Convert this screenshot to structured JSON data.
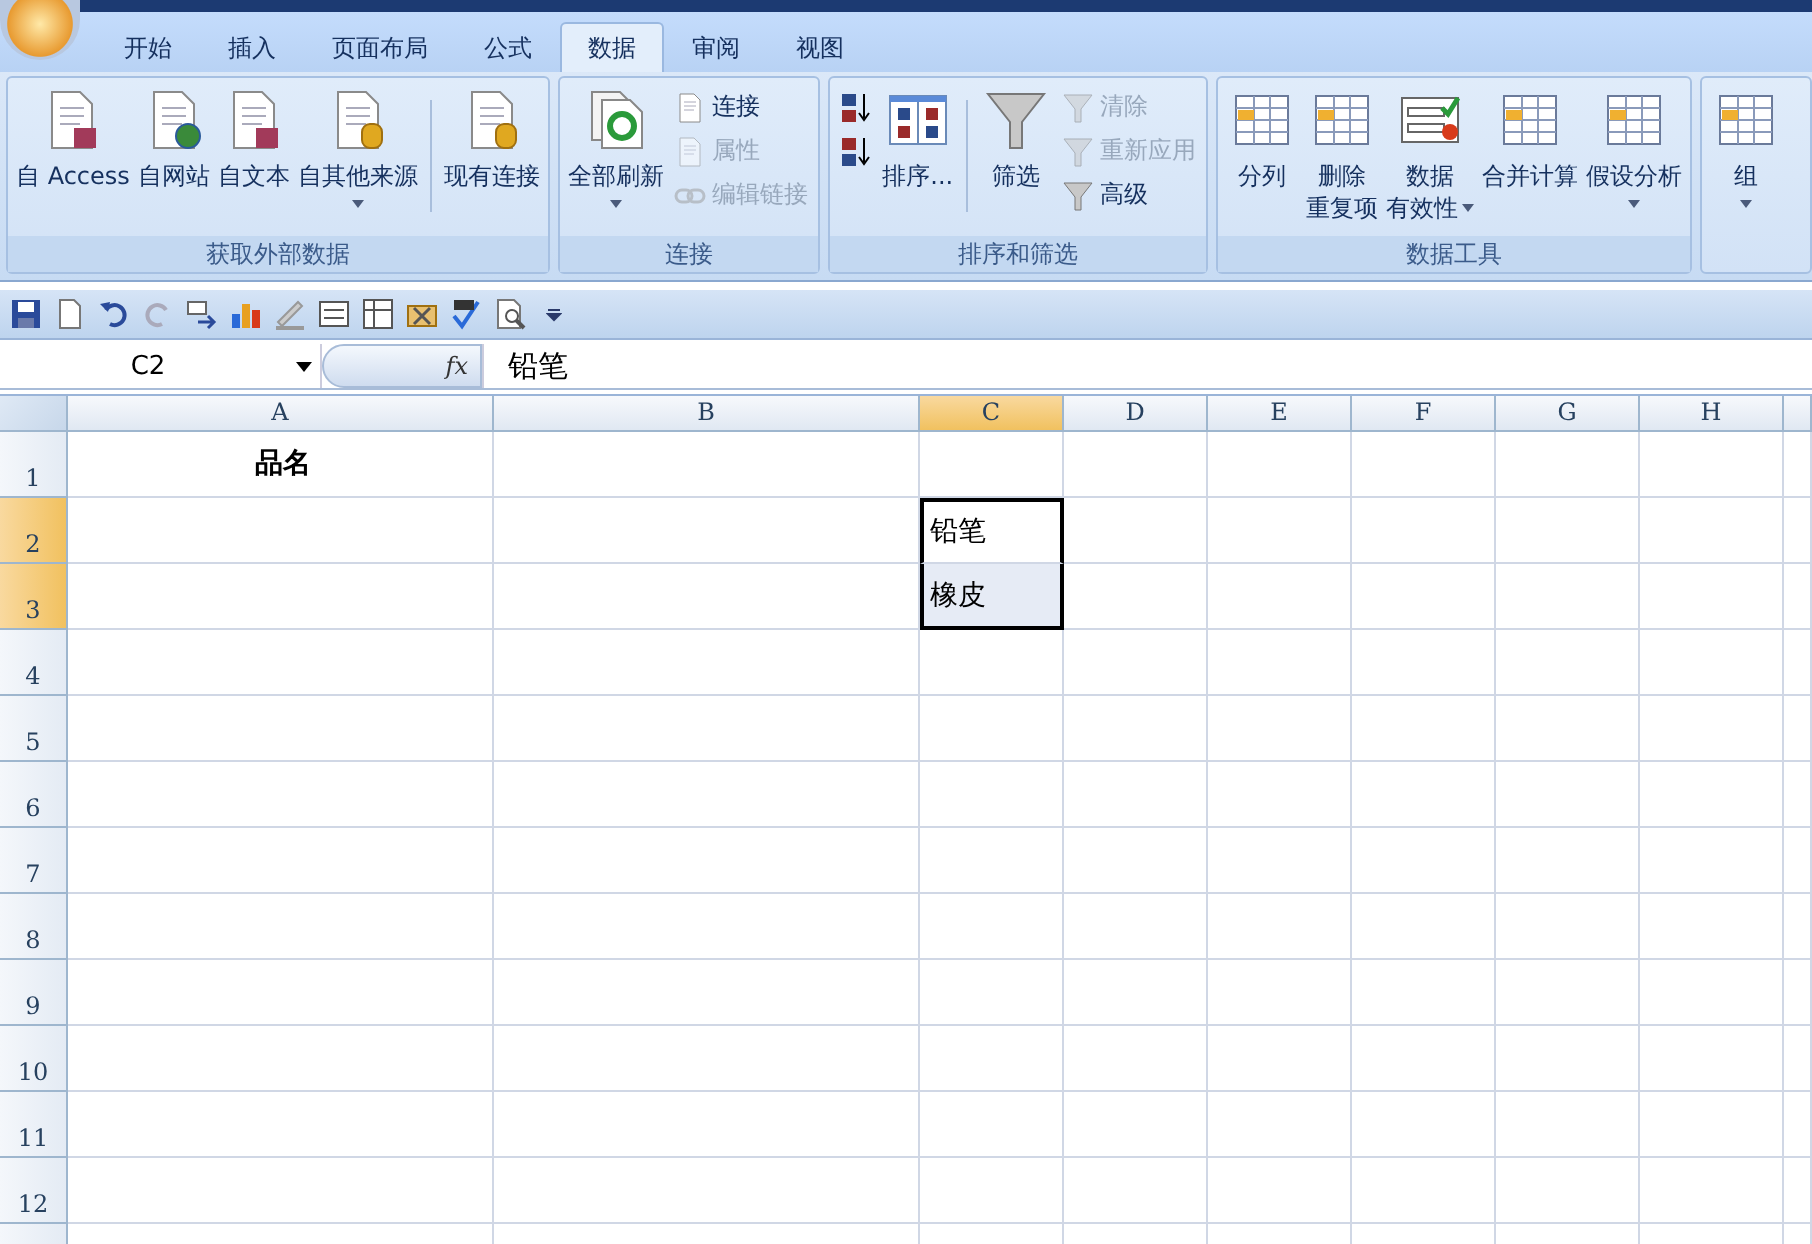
{
  "tabs": [
    {
      "label": "开始",
      "selected": false
    },
    {
      "label": "插入",
      "selected": false
    },
    {
      "label": "页面布局",
      "selected": false
    },
    {
      "label": "公式",
      "selected": false
    },
    {
      "label": "数据",
      "selected": true
    },
    {
      "label": "审阅",
      "selected": false
    },
    {
      "label": "视图",
      "selected": false
    }
  ],
  "ribbon": {
    "groups": [
      {
        "title": "获取外部数据",
        "items": [
          {
            "kind": "large",
            "label": "自 Access",
            "menu": false
          },
          {
            "kind": "large",
            "label": "自网站",
            "menu": false
          },
          {
            "kind": "large",
            "label": "自文本",
            "menu": false
          },
          {
            "kind": "large",
            "label": "自其他来源",
            "menu": true
          },
          {
            "kind": "separator"
          },
          {
            "kind": "large",
            "label": "现有连接",
            "menu": false
          }
        ]
      },
      {
        "title": "连接",
        "items": [
          {
            "kind": "large",
            "label": "全部刷新",
            "menu": true
          },
          {
            "kind": "stack",
            "buttons": [
              {
                "label": "连接",
                "disabled": false
              },
              {
                "label": "属性",
                "disabled": true
              },
              {
                "label": "编辑链接",
                "disabled": true
              }
            ]
          }
        ]
      },
      {
        "title": "排序和筛选",
        "items": [
          {
            "kind": "stack",
            "buttons": [
              {
                "disabled": false
              },
              {
                "disabled": false
              }
            ]
          },
          {
            "kind": "large",
            "label": "排序...",
            "menu": false
          },
          {
            "kind": "separator"
          },
          {
            "kind": "large",
            "label": "筛选",
            "menu": false
          },
          {
            "kind": "stack",
            "buttons": [
              {
                "label": "清除",
                "disabled": true
              },
              {
                "label": "重新应用",
                "disabled": true
              },
              {
                "label": "高级",
                "disabled": false
              }
            ]
          }
        ]
      },
      {
        "title": "数据工具",
        "items": [
          {
            "kind": "large",
            "label": "分列",
            "menu": false
          },
          {
            "kind": "large",
            "label": "删除",
            "label_2": "重复项",
            "menu": false
          },
          {
            "kind": "large",
            "label": "数据",
            "label_2": "有效性",
            "menu": true
          },
          {
            "kind": "large",
            "label": "合并计算",
            "menu": false
          },
          {
            "kind": "large",
            "label": "假设分析",
            "menu": true
          }
        ]
      },
      {
        "items": [
          {
            "kind": "large",
            "label": "组",
            "menu": true
          }
        ]
      }
    ]
  },
  "formula_bar": {
    "name_box": "C2",
    "fx": "fx",
    "value": "铅笔"
  },
  "sheet": {
    "columns": [
      {
        "label": "A",
        "selected": false
      },
      {
        "label": "B",
        "selected": false
      },
      {
        "label": "C",
        "selected": true
      },
      {
        "label": "D",
        "selected": false
      },
      {
        "label": "E",
        "selected": false
      },
      {
        "label": "F",
        "selected": false
      },
      {
        "label": "G",
        "selected": false
      },
      {
        "label": "H",
        "selected": false
      }
    ],
    "rows": [
      {
        "label": "1",
        "selected": false,
        "cells": [
          {
            "text": "品名",
            "bold": true,
            "selected": false,
            "active": false
          }
        ]
      },
      {
        "label": "2",
        "selected": true,
        "cells": [
          null,
          null,
          {
            "text": "铅笔",
            "bold": false,
            "selected": true,
            "active": true
          }
        ]
      },
      {
        "label": "3",
        "selected": true,
        "cells": [
          null,
          null,
          {
            "text": "橡皮",
            "bold": false,
            "selected": true,
            "active": false
          }
        ]
      },
      {
        "label": "4",
        "selected": false
      },
      {
        "label": "5",
        "selected": false
      },
      {
        "label": "6",
        "selected": false
      },
      {
        "label": "7",
        "selected": false
      },
      {
        "label": "8",
        "selected": false
      },
      {
        "label": "9",
        "selected": false
      },
      {
        "label": "10",
        "selected": false
      },
      {
        "label": "11",
        "selected": false
      },
      {
        "label": "12",
        "selected": false
      }
    ]
  }
}
